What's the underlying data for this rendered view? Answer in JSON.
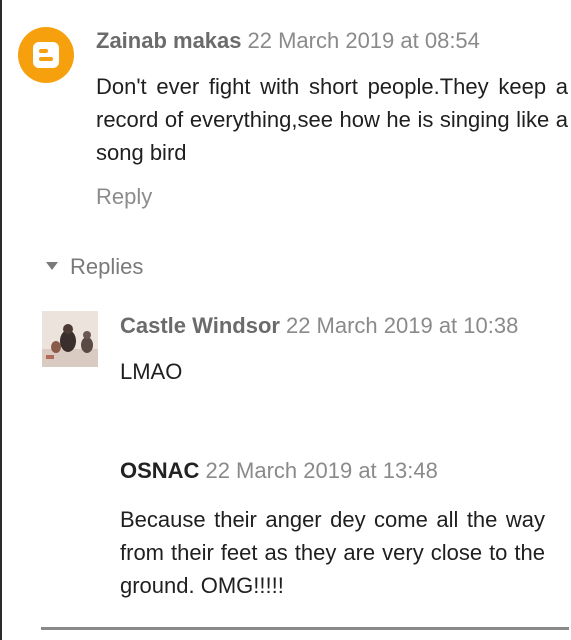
{
  "comments": [
    {
      "author": "Zainab makas",
      "timestamp": "22 March 2019 at 08:54",
      "body": "Don't ever fight with short people.They keep a record of everything,see how he is singing like a song bird",
      "reply_label": "Reply"
    }
  ],
  "replies_section": {
    "toggle_label": "Replies",
    "items": [
      {
        "author": "Castle Windsor",
        "timestamp": "22 March 2019 at 10:38",
        "body": "LMAO"
      },
      {
        "author": "OSNAC",
        "timestamp": "22 March 2019 at 13:48",
        "body": "Because their anger dey come all the way from their feet as they are very close to the ground. OMG!!!!!"
      }
    ]
  },
  "colors": {
    "blogger_orange": "#f6a00d",
    "meta_grey": "#8a8a8a",
    "text": "#1f1f1f"
  },
  "icons": {
    "top_comment_avatar": "blogger-logo-icon",
    "toggle": "caret-down-icon"
  }
}
